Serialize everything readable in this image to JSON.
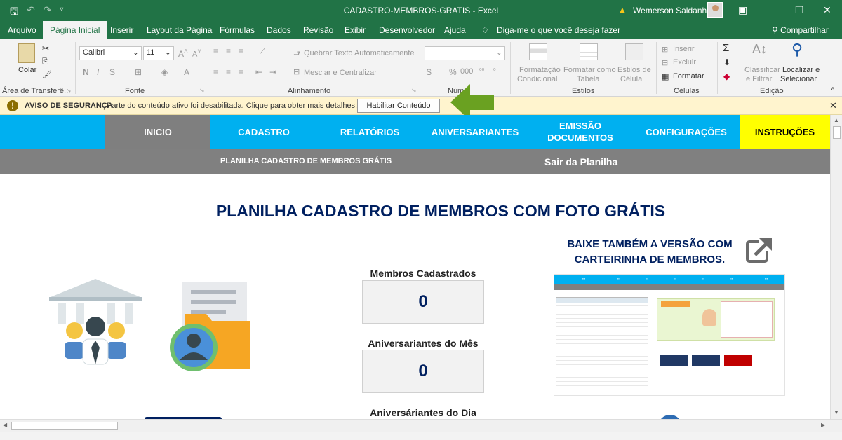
{
  "window": {
    "title": "CADASTRO-MEMBROS-GRATIS  -  Excel",
    "user": "Wemerson Saldanha"
  },
  "menu": {
    "tabs": [
      "Arquivo",
      "Página Inicial",
      "Inserir",
      "Layout da Página",
      "Fórmulas",
      "Dados",
      "Revisão",
      "Exibir",
      "Desenvolvedor",
      "Ajuda"
    ],
    "tellme": "Diga-me o que você deseja fazer",
    "share": "Compartilhar"
  },
  "ribbon": {
    "paste": "Colar",
    "font_name": "Calibri",
    "font_size": "11",
    "wrap_text": "Quebrar Texto Automaticamente",
    "merge_center": "Mesclar e Centralizar",
    "cond_format": [
      "Formatação",
      "Condicional"
    ],
    "format_table": [
      "Formatar como",
      "Tabela"
    ],
    "cell_styles": [
      "Estilos de",
      "Célula"
    ],
    "insert": "Inserir",
    "delete": "Excluir",
    "format": "Formatar",
    "sort_filter": [
      "Classificar",
      "e Filtrar"
    ],
    "find_select": [
      "Localizar e",
      "Selecionar"
    ],
    "groups": {
      "clipboard": "Área de Transferê...",
      "font": "Fonte",
      "alignment": "Alinhamento",
      "number": "Núm",
      "styles": "Estilos",
      "cells": "Células",
      "editing": "Edição"
    }
  },
  "security": {
    "title": "AVISO DE SEGURANÇA",
    "message": "Parte do conteúdo ativo foi desabilitada. Clique para obter mais detalhes.",
    "button": "Habilitar Conteúdo"
  },
  "sheet": {
    "nav": {
      "inicio": "INICIO",
      "cadastro": "CADASTRO",
      "relatorios": "RELATÓRIOS",
      "aniversariantes": "ANIVERSARIANTES",
      "emissao_1": "EMISSÃO",
      "emissao_2": "DOCUMENTOS",
      "configuracoes": "CONFIGURAÇÕES",
      "instrucoes": "INSTRUÇÕES"
    },
    "subnav": {
      "left": "PLANILHA CADASTRO DE MEMBROS GRÁTIS",
      "right": "Sair da Planilha"
    },
    "title": "PLANILHA CADASTRO DE MEMBROS COM FOTO GRÁTIS",
    "stats": {
      "members_label": "Membros Cadastrados",
      "members_value": "0",
      "month_label": "Aniversariantes do Mês",
      "month_value": "0",
      "day_label": "Aniversáriantes do Dia"
    },
    "promo": {
      "line1": "BAIXE TAMBÉM A VERSÃO COM",
      "line2": "CARTEIRINHA DE MEMBROS."
    }
  },
  "colors": {
    "excel_green": "#217346",
    "nav_blue": "#00b0f0",
    "nav_grey": "#7f7f7f",
    "nav_yellow": "#ffff00",
    "title_navy": "#002060",
    "security_bg": "#fff4ce",
    "arrow_green": "#6aa121"
  }
}
